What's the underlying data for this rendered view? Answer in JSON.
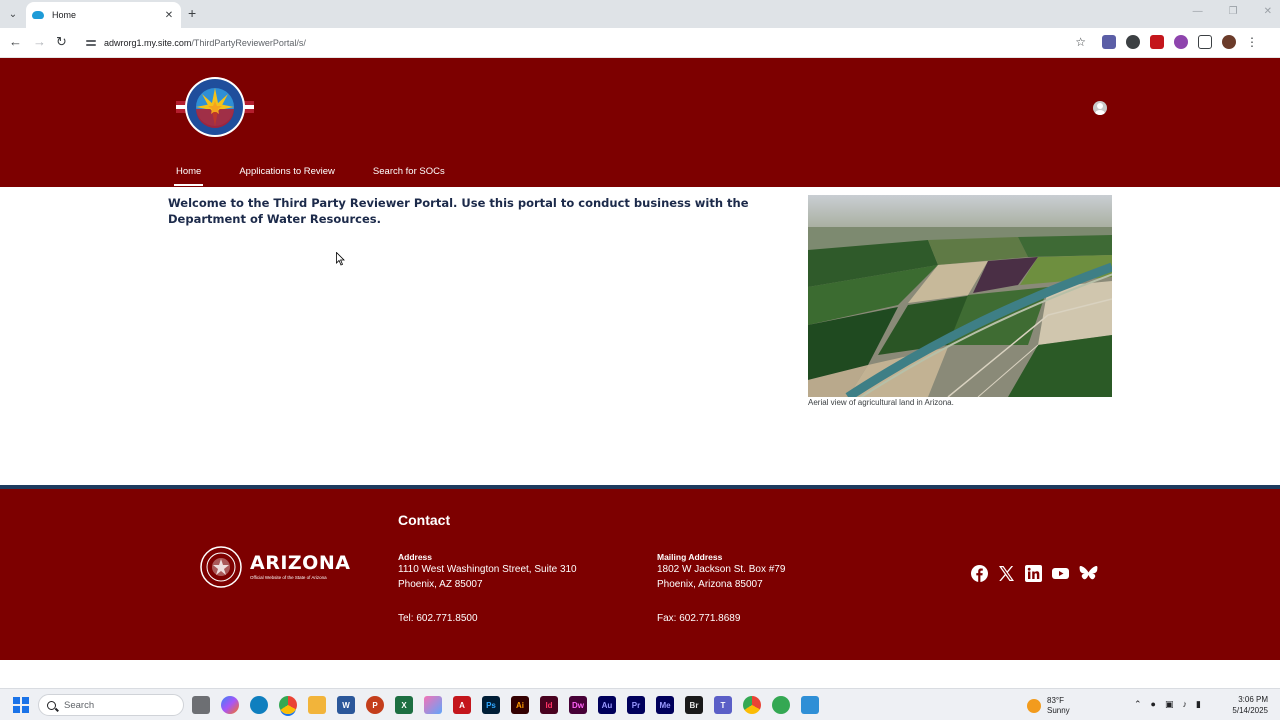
{
  "browser": {
    "tab_title": "Home",
    "url_host": "adwrorg1.my.site.com",
    "url_path": "/ThirdPartyReviewerPortal/s/"
  },
  "header": {
    "nav": [
      {
        "label": "Home",
        "active": true
      },
      {
        "label": "Applications to Review",
        "active": false
      },
      {
        "label": "Search for SOCs",
        "active": false
      }
    ]
  },
  "main": {
    "welcome": "Welcome to the Third Party Reviewer Portal. Use this portal to conduct business with the Department of Water Resources.",
    "image_caption": "Aerial view of agricultural land in Arizona."
  },
  "footer": {
    "az_wordmark": "ARIZONA",
    "az_subtitle": "Official Website of the State of Arizona",
    "contact_title": "Contact",
    "address": {
      "label": "Address",
      "line1": "1110 West Washington Street, Suite 310",
      "line2": "Phoenix, AZ 85007",
      "phone": "Tel: 602.771.8500"
    },
    "mailing": {
      "label": "Mailing Address",
      "line1": "1802 W Jackson St. Box #79",
      "line2": "Phoenix, Arizona 85007",
      "phone": "Fax: 602.771.8689"
    }
  },
  "taskbar": {
    "search_placeholder": "Search",
    "weather_temp": "83°F",
    "weather_desc": "Sunny",
    "time": "3:06 PM",
    "date": "5/14/2025"
  },
  "colors": {
    "header_bg": "#7d0000",
    "footer_stripe": "#1d3b5e",
    "welcome_text": "#1c2a4a"
  }
}
